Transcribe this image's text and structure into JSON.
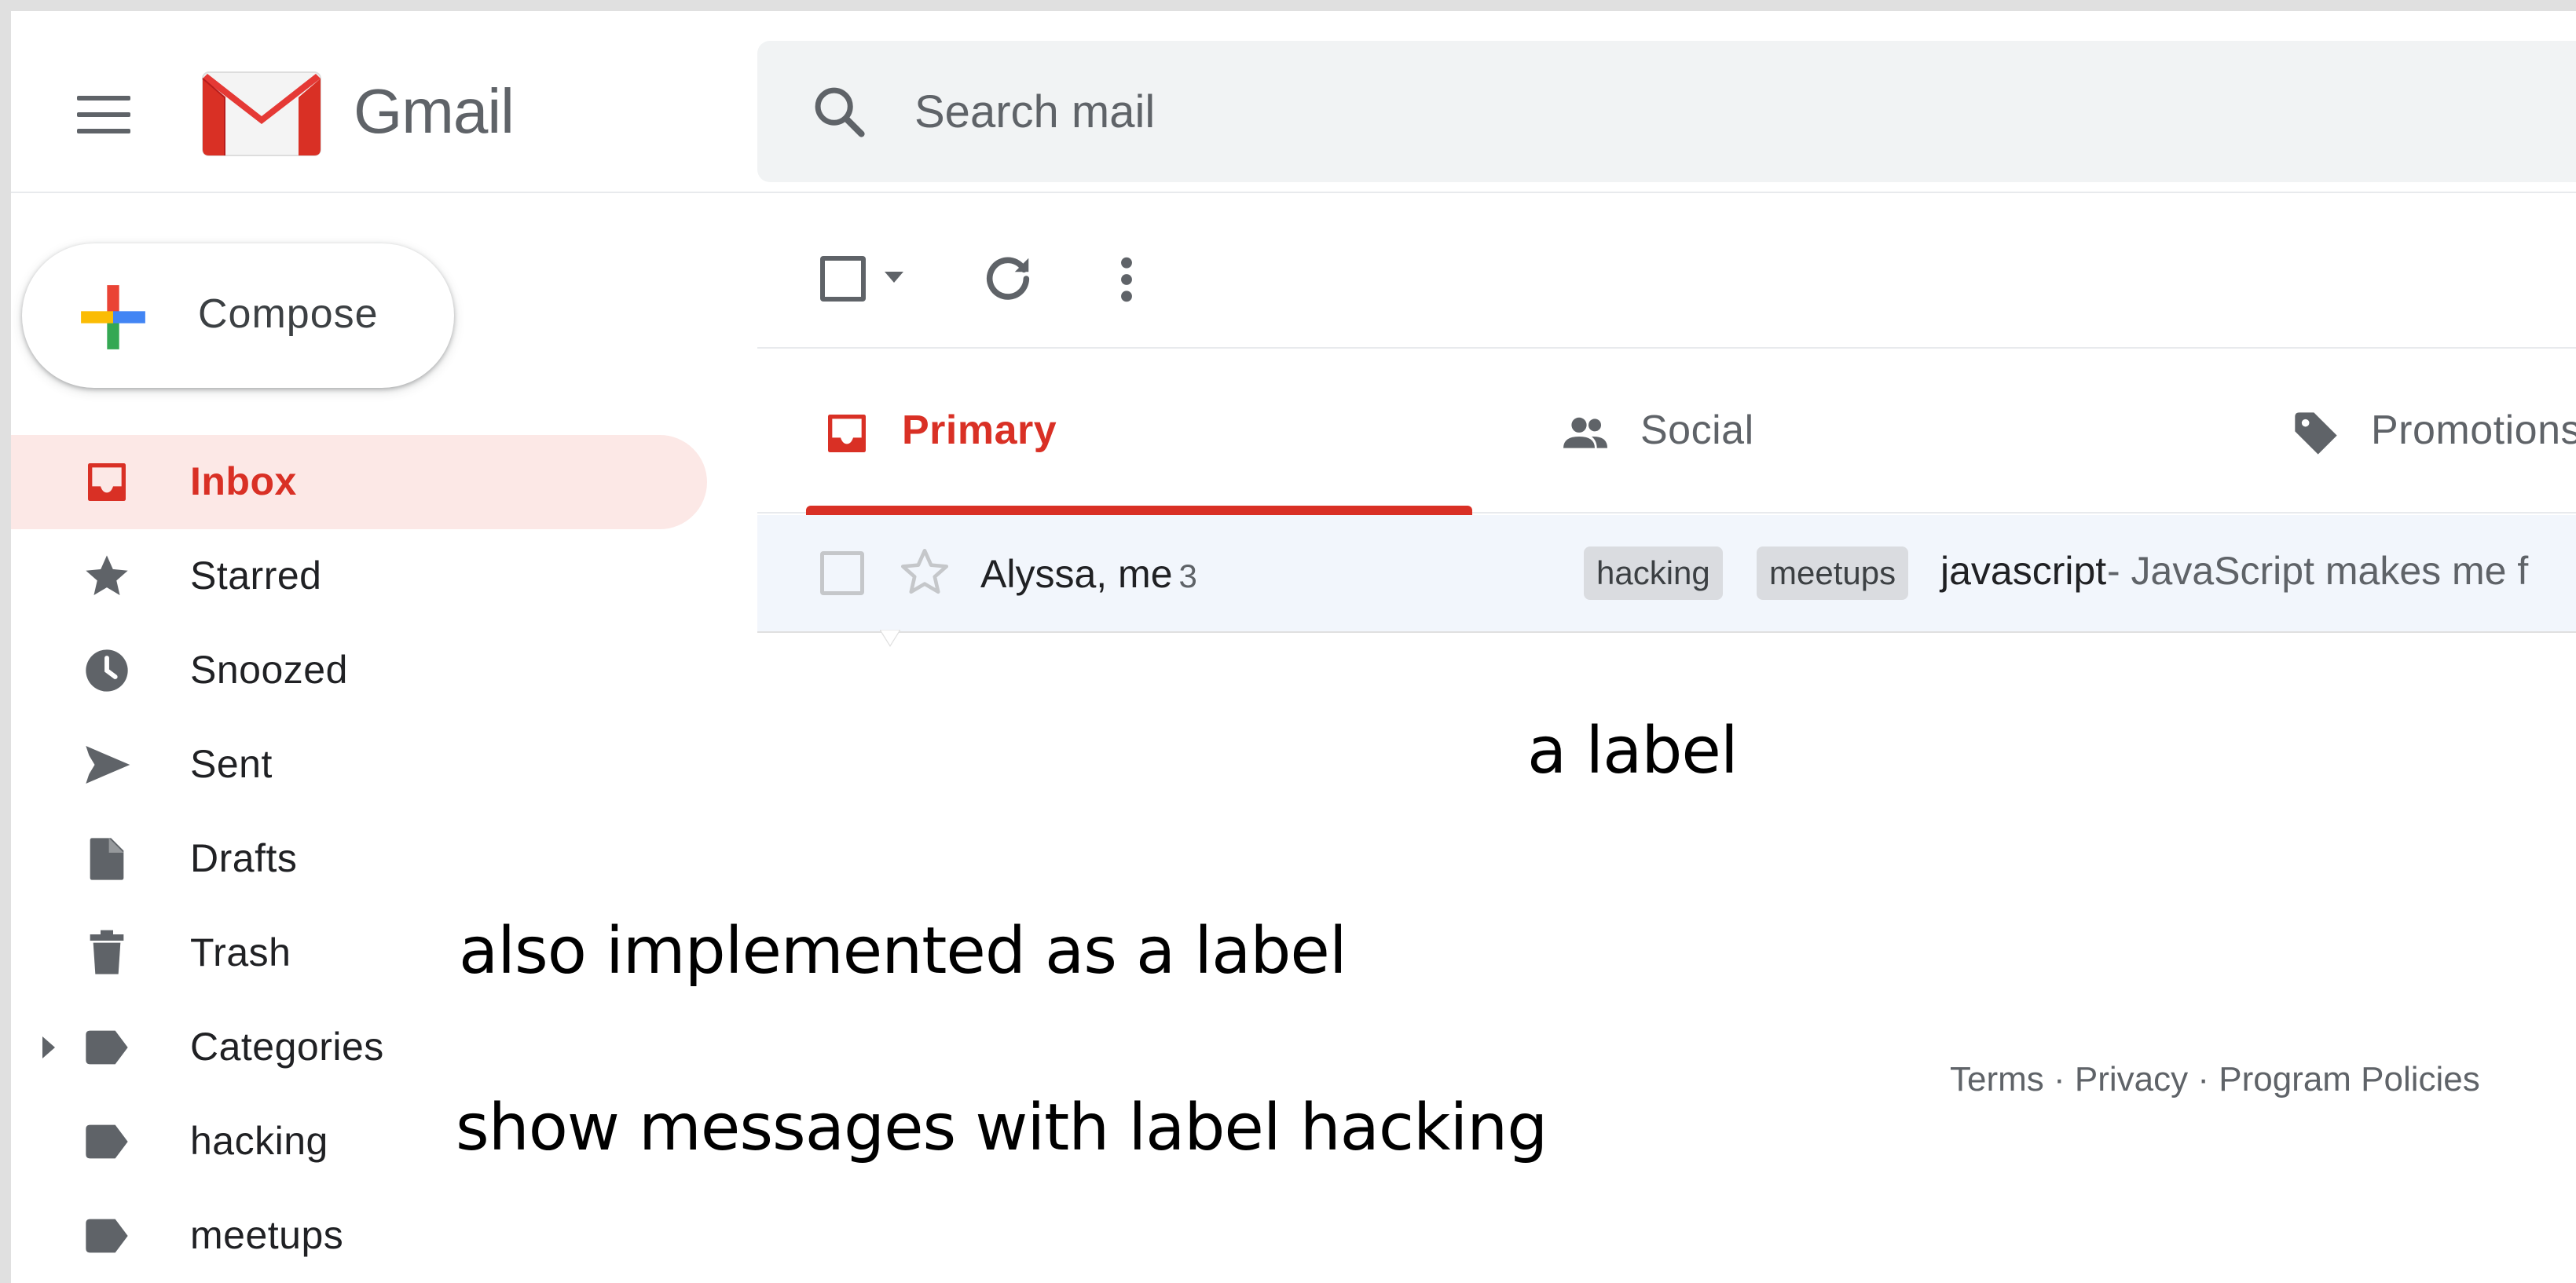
{
  "header": {
    "brand": "Gmail",
    "search_placeholder": "Search mail"
  },
  "sidebar": {
    "compose_label": "Compose",
    "items": [
      {
        "label": "Inbox",
        "icon": "inbox-icon",
        "active": true
      },
      {
        "label": "Starred",
        "icon": "star-icon"
      },
      {
        "label": "Snoozed",
        "icon": "clock-icon"
      },
      {
        "label": "Sent",
        "icon": "send-icon"
      },
      {
        "label": "Drafts",
        "icon": "draft-icon"
      },
      {
        "label": "Trash",
        "icon": "trash-icon"
      },
      {
        "label": "Categories",
        "icon": "label-icon",
        "expandable": true
      },
      {
        "label": "hacking",
        "icon": "label-icon"
      },
      {
        "label": "meetups",
        "icon": "label-icon"
      }
    ]
  },
  "tabs": [
    {
      "label": "Primary",
      "icon": "inbox-icon",
      "active": true
    },
    {
      "label": "Social",
      "icon": "people-icon"
    },
    {
      "label": "Promotions",
      "icon": "tag-icon"
    }
  ],
  "message": {
    "sender": "Alyssa, me",
    "count": "3",
    "labels": [
      "hacking",
      "meetups"
    ],
    "subject": "javascript",
    "snippet": "- JavaScript makes me f"
  },
  "footer": {
    "links": "Terms · Privacy · Program Policies"
  },
  "annotations": {
    "label_note": "a label",
    "trash_note": "also implemented as a label",
    "hacking_note": "show messages with label hacking"
  },
  "colors": {
    "accent": "#d93025",
    "active_bg": "#fce8e6",
    "chip_bg": "#dadce0",
    "search_bg": "#f1f3f4"
  }
}
